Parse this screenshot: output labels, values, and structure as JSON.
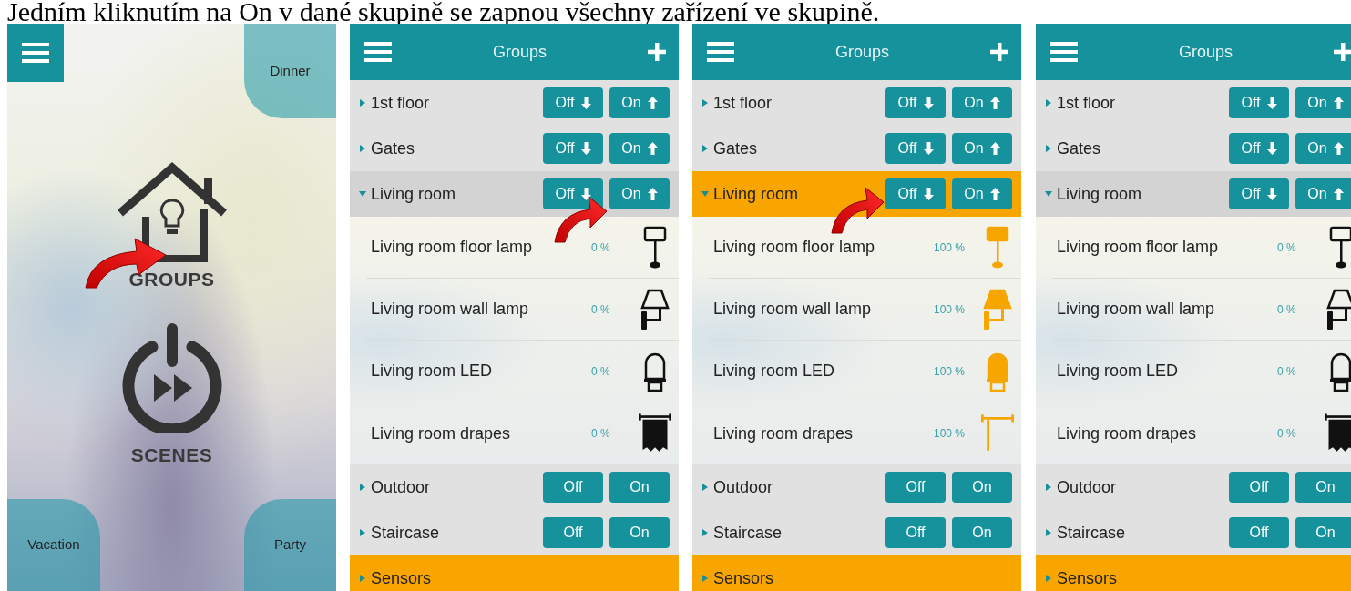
{
  "caption": "Jedním kliknutím na On v dané skupině se zapnou všechny zařízení ve skupině.",
  "home": {
    "corners": [
      "Dinner",
      "Vacation",
      "Party"
    ],
    "tiles": [
      {
        "kind": "groups",
        "label": "GROUPS",
        "pointer": true
      },
      {
        "kind": "scenes",
        "label": "SCENES"
      }
    ]
  },
  "screens": [
    {
      "title": "Groups",
      "groups": [
        {
          "name": "1st floor",
          "expanded": false,
          "highlighted": false,
          "arrows": true,
          "off": "Off",
          "on": "On"
        },
        {
          "name": "Gates",
          "expanded": false,
          "highlighted": false,
          "arrows": true,
          "off": "Off",
          "on": "On"
        },
        {
          "name": "Living room",
          "expanded": true,
          "highlighted": false,
          "arrows": true,
          "pointer": true,
          "off": "Off",
          "on": "On",
          "devices": [
            {
              "kind": "floor-lamp",
              "name": "Living room floor lamp",
              "reading": "0 %",
              "on": false
            },
            {
              "kind": "wall-lamp",
              "name": "Living room wall lamp",
              "reading": "0 %",
              "on": false
            },
            {
              "kind": "led",
              "name": "Living room LED",
              "reading": "0 %",
              "on": false
            },
            {
              "kind": "drapes",
              "name": "Living room drapes",
              "reading": "0 %",
              "on": false
            }
          ]
        },
        {
          "name": "Outdoor",
          "expanded": false,
          "highlighted": false,
          "arrows": false,
          "off": "Off",
          "on": "On"
        },
        {
          "name": "Staircase",
          "expanded": false,
          "highlighted": false,
          "arrows": false,
          "off": "Off",
          "on": "On"
        },
        {
          "name": "Sensors",
          "expanded": false,
          "highlighted": true
        }
      ]
    },
    {
      "title": "Groups",
      "groups": [
        {
          "name": "1st floor",
          "expanded": false,
          "highlighted": false,
          "arrows": true,
          "off": "Off",
          "on": "On"
        },
        {
          "name": "Gates",
          "expanded": false,
          "highlighted": false,
          "arrows": true,
          "off": "Off",
          "on": "On"
        },
        {
          "name": "Living room",
          "expanded": true,
          "highlighted": true,
          "arrows": true,
          "pointer": true,
          "off": "Off",
          "on": "On",
          "devices": [
            {
              "kind": "floor-lamp",
              "name": "Living room floor lamp",
              "reading": "100 %",
              "on": true
            },
            {
              "kind": "wall-lamp",
              "name": "Living room wall lamp",
              "reading": "100 %",
              "on": true
            },
            {
              "kind": "led",
              "name": "Living room LED",
              "reading": "100 %",
              "on": true
            },
            {
              "kind": "drapes",
              "name": "Living room drapes",
              "reading": "100 %",
              "on": true
            }
          ]
        },
        {
          "name": "Outdoor",
          "expanded": false,
          "highlighted": false,
          "arrows": false,
          "off": "Off",
          "on": "On"
        },
        {
          "name": "Staircase",
          "expanded": false,
          "highlighted": false,
          "arrows": false,
          "off": "Off",
          "on": "On"
        },
        {
          "name": "Sensors",
          "expanded": false,
          "highlighted": true
        }
      ]
    },
    {
      "title": "Groups",
      "groups": [
        {
          "name": "1st floor",
          "expanded": false,
          "highlighted": false,
          "arrows": true,
          "off": "Off",
          "on": "On"
        },
        {
          "name": "Gates",
          "expanded": false,
          "highlighted": false,
          "arrows": true,
          "off": "Off",
          "on": "On"
        },
        {
          "name": "Living room",
          "expanded": true,
          "highlighted": false,
          "arrows": true,
          "off": "Off",
          "on": "On",
          "devices": [
            {
              "kind": "floor-lamp",
              "name": "Living room floor lamp",
              "reading": "0 %",
              "on": false
            },
            {
              "kind": "wall-lamp",
              "name": "Living room wall lamp",
              "reading": "0 %",
              "on": false
            },
            {
              "kind": "led",
              "name": "Living room LED",
              "reading": "0 %",
              "on": false
            },
            {
              "kind": "drapes",
              "name": "Living room drapes",
              "reading": "0 %",
              "on": false
            }
          ]
        },
        {
          "name": "Outdoor",
          "expanded": false,
          "highlighted": false,
          "arrows": false,
          "off": "Off",
          "on": "On"
        },
        {
          "name": "Staircase",
          "expanded": false,
          "highlighted": false,
          "arrows": false,
          "off": "Off",
          "on": "On"
        },
        {
          "name": "Sensors",
          "expanded": false,
          "highlighted": true
        }
      ]
    }
  ]
}
